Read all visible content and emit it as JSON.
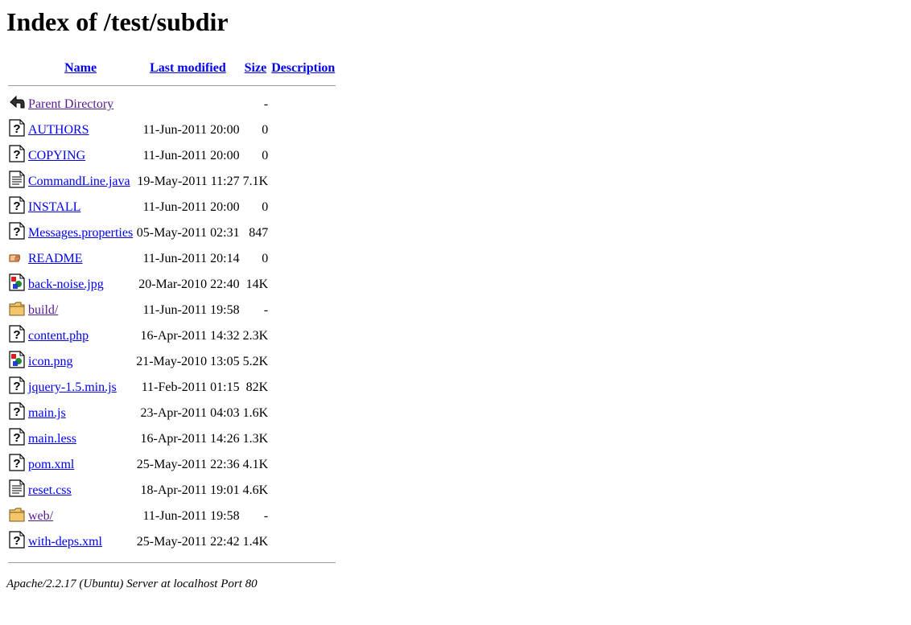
{
  "page": {
    "title": "Index of /test/subdir"
  },
  "table": {
    "headers": {
      "name": "Name",
      "modified": "Last modified",
      "size": "Size",
      "description": "Description"
    },
    "rows": [
      {
        "icon": "back-arrow-icon",
        "name": "Parent Directory",
        "modified": "",
        "size": "-",
        "visited": true
      },
      {
        "icon": "unknown-file-icon",
        "name": "AUTHORS",
        "modified": "11-Jun-2011 20:00",
        "size": "0",
        "visited": false
      },
      {
        "icon": "unknown-file-icon",
        "name": "COPYING",
        "modified": "11-Jun-2011 20:00",
        "size": "0",
        "visited": false
      },
      {
        "icon": "text-file-icon",
        "name": "CommandLine.java",
        "modified": "19-May-2011 11:27",
        "size": "7.1K",
        "visited": false
      },
      {
        "icon": "unknown-file-icon",
        "name": "INSTALL",
        "modified": "11-Jun-2011 20:00",
        "size": "0",
        "visited": false
      },
      {
        "icon": "unknown-file-icon",
        "name": "Messages.properties",
        "modified": "05-May-2011 02:31",
        "size": "847",
        "visited": false
      },
      {
        "icon": "readme-hand-icon",
        "name": "README",
        "modified": "11-Jun-2011 20:14",
        "size": "0",
        "visited": false
      },
      {
        "icon": "image-file-icon",
        "name": "back-noise.jpg",
        "modified": "20-Mar-2010 22:40",
        "size": "14K",
        "visited": false
      },
      {
        "icon": "folder-icon",
        "name": "build/",
        "modified": "11-Jun-2011 19:58",
        "size": "-",
        "visited": true
      },
      {
        "icon": "unknown-file-icon",
        "name": "content.php",
        "modified": "16-Apr-2011 14:32",
        "size": "2.3K",
        "visited": false
      },
      {
        "icon": "image-file-icon",
        "name": "icon.png",
        "modified": "21-May-2010 13:05",
        "size": "5.2K",
        "visited": false
      },
      {
        "icon": "unknown-file-icon",
        "name": "jquery-1.5.min.js",
        "modified": "11-Feb-2011 01:15",
        "size": "82K",
        "visited": false
      },
      {
        "icon": "unknown-file-icon",
        "name": "main.js",
        "modified": "23-Apr-2011 04:03",
        "size": "1.6K",
        "visited": false
      },
      {
        "icon": "unknown-file-icon",
        "name": "main.less",
        "modified": "16-Apr-2011 14:26",
        "size": "1.3K",
        "visited": false
      },
      {
        "icon": "unknown-file-icon",
        "name": "pom.xml",
        "modified": "25-May-2011 22:36",
        "size": "4.1K",
        "visited": false
      },
      {
        "icon": "text-file-icon",
        "name": "reset.css",
        "modified": "18-Apr-2011 19:01",
        "size": "4.6K",
        "visited": false
      },
      {
        "icon": "folder-icon",
        "name": "web/",
        "modified": "11-Jun-2011 19:58",
        "size": "-",
        "visited": true
      },
      {
        "icon": "unknown-file-icon",
        "name": "with-deps.xml",
        "modified": "25-May-2011 22:42",
        "size": "1.4K",
        "visited": false
      }
    ]
  },
  "footer": {
    "address": "Apache/2.2.17 (Ubuntu) Server at localhost Port 80"
  },
  "colors": {
    "link": "#0000ee",
    "visited": "#551a8b",
    "rule": "#9a9a9a"
  }
}
